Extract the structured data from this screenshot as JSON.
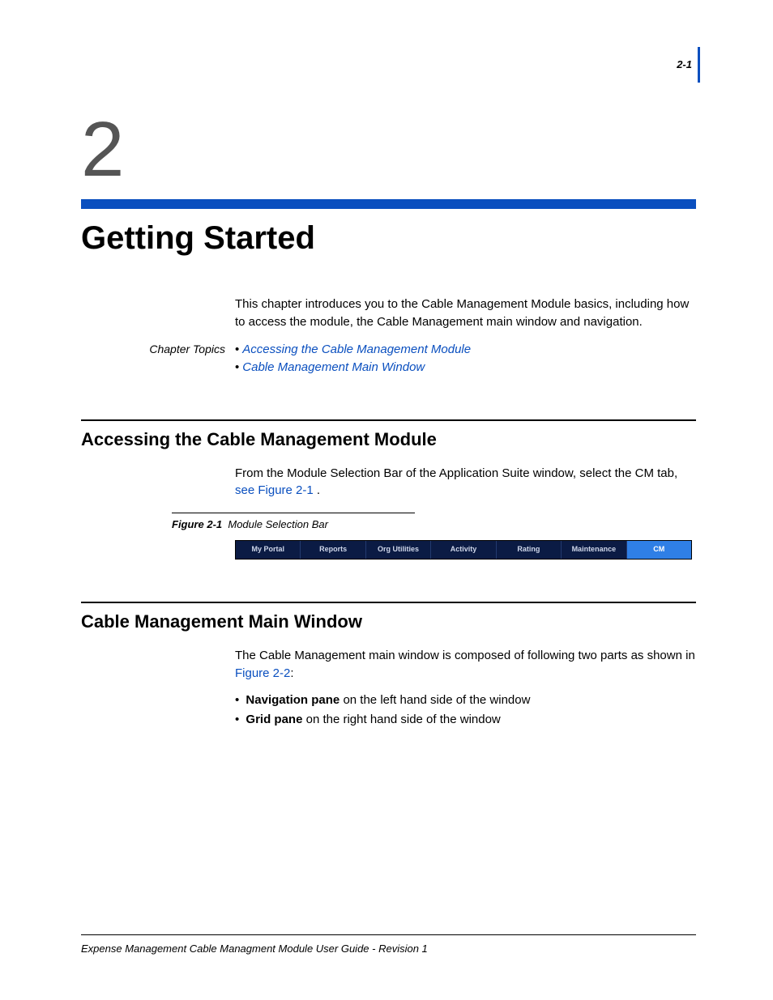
{
  "page_number": "2-1",
  "chapter_number": "2",
  "chapter_title": "Getting Started",
  "intro": "This chapter introduces you to the Cable Management Module basics, including how to access the module, the Cable Management main window and navigation.",
  "topics_label": "Chapter Topics",
  "topics": [
    "Accessing the Cable Management Module",
    "Cable Management Main Window"
  ],
  "section1": {
    "title": "Accessing the Cable Management Module",
    "body_prefix": "From the Module Selection Bar of the Application Suite window, select the CM tab, ",
    "body_link": "see Figure 2-1",
    "body_suffix": " ."
  },
  "figure": {
    "num": "Figure 2-1",
    "title": "Module Selection Bar",
    "tabs": [
      "My Portal",
      "Reports",
      "Org Utilities",
      "Activity",
      "Rating",
      "Maintenance",
      "CM"
    ],
    "active_index": 6
  },
  "section2": {
    "title": "Cable Management Main Window",
    "body_prefix": "The Cable Management main window is composed of following two parts as shown in ",
    "body_link": "Figure 2-2",
    "body_suffix": ":",
    "bullets": [
      {
        "bold": "Navigation pane",
        "rest": " on the left hand side of the window"
      },
      {
        "bold": "Grid pane",
        "rest": " on the right hand side of the window"
      }
    ]
  },
  "footer": "Expense Management Cable Managment Module User Guide - Revision 1"
}
